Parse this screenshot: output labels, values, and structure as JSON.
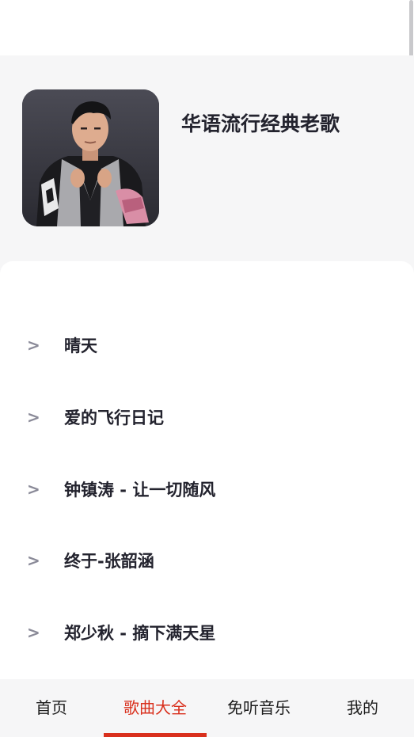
{
  "playlist": {
    "title": "华语流行经典老歌",
    "cover_alt": "album-cover-photo"
  },
  "songs": [
    {
      "arrow": ">",
      "title": "晴天"
    },
    {
      "arrow": ">",
      "title": "爱的飞行日记"
    },
    {
      "arrow": ">",
      "title": "钟镇涛 - 让一切随风"
    },
    {
      "arrow": ">",
      "title": "终于-张韶涵"
    },
    {
      "arrow": ">",
      "title": "郑少秋 - 摘下满天星"
    }
  ],
  "tabs": [
    {
      "label": "首页",
      "active": false
    },
    {
      "label": "歌曲大全",
      "active": true
    },
    {
      "label": "免听音乐",
      "active": false
    },
    {
      "label": "我的",
      "active": false
    }
  ],
  "colors": {
    "accent": "#d9301d",
    "header_bg": "#f6f6f7",
    "text_primary": "#23232e",
    "arrow": "#8a8a98"
  }
}
